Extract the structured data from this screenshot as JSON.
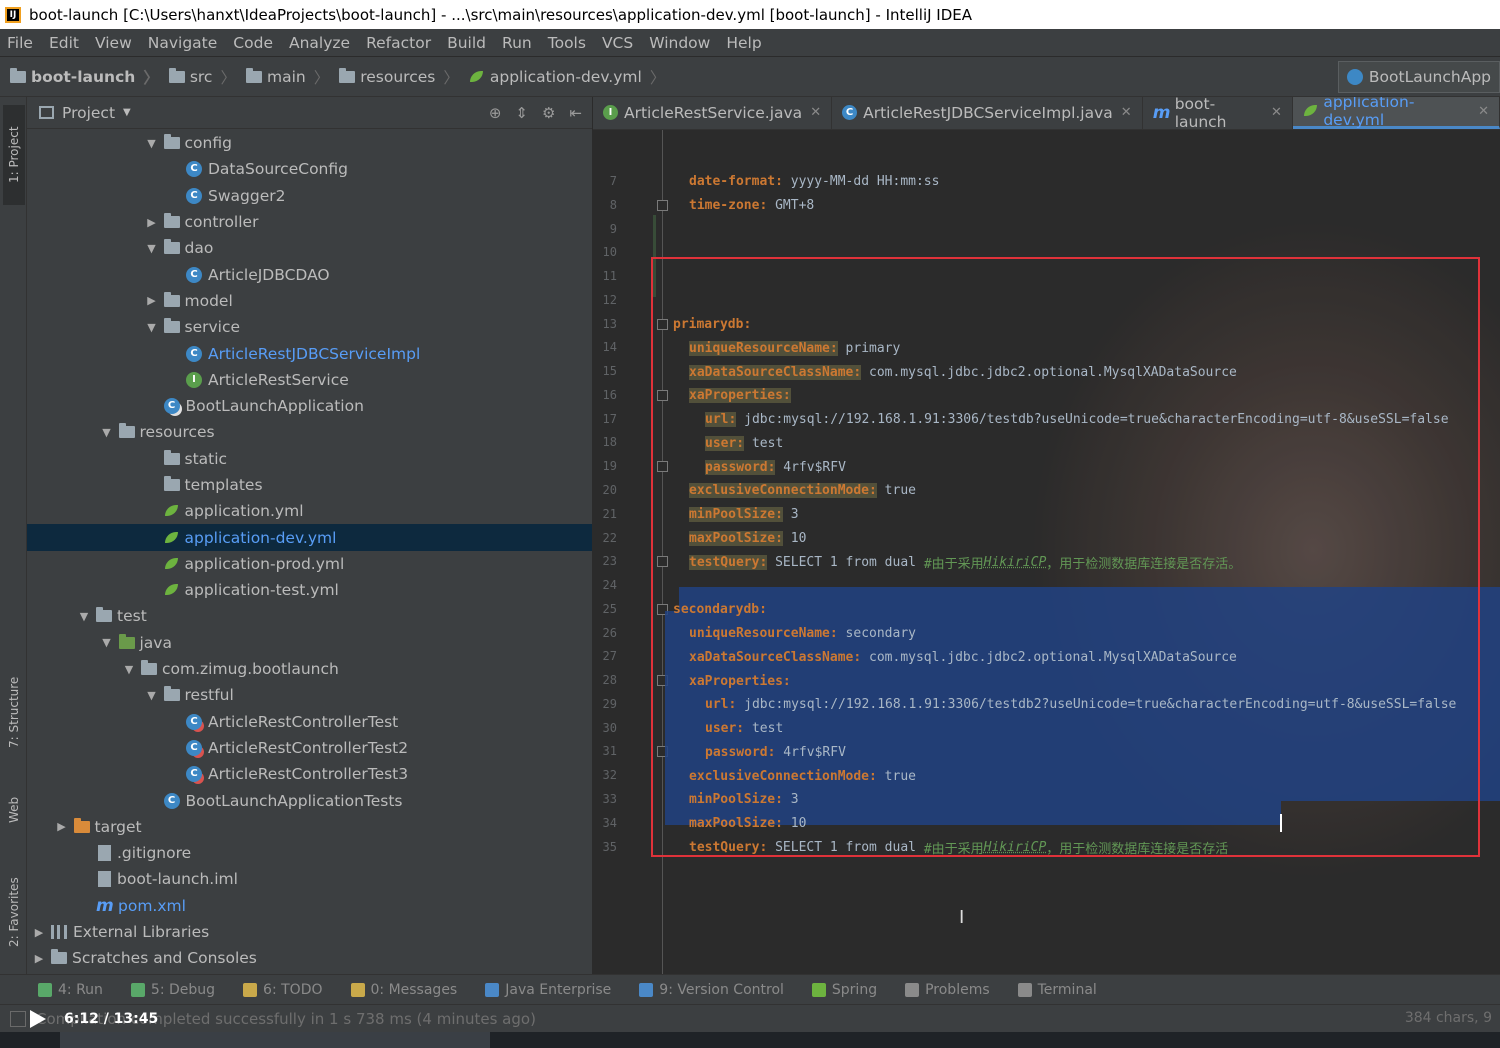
{
  "window": {
    "title": "boot-launch [C:\\Users\\hanxt\\IdeaProjects\\boot-launch] - ...\\src\\main\\resources\\application-dev.yml [boot-launch] - IntelliJ IDEA",
    "app_icon": "IJ"
  },
  "menu": [
    "File",
    "Edit",
    "View",
    "Navigate",
    "Code",
    "Analyze",
    "Refactor",
    "Build",
    "Run",
    "Tools",
    "VCS",
    "Window",
    "Help"
  ],
  "breadcrumbs": [
    "boot-launch",
    "src",
    "main",
    "resources",
    "application-dev.yml"
  ],
  "run_config": "BootLaunchApp",
  "left_tabs": [
    "1: Project",
    "7: Structure",
    "Web",
    "2: Favorites"
  ],
  "project_panel": {
    "title": "Project",
    "tree": [
      {
        "label": "config",
        "type": "folder",
        "expanded": true
      },
      {
        "label": "DataSourceConfig",
        "type": "class"
      },
      {
        "label": "Swagger2",
        "type": "class"
      },
      {
        "label": "controller",
        "type": "folder",
        "expanded": false
      },
      {
        "label": "dao",
        "type": "folder",
        "expanded": true
      },
      {
        "label": "ArticleJDBCDAO",
        "type": "class"
      },
      {
        "label": "model",
        "type": "folder",
        "expanded": false
      },
      {
        "label": "service",
        "type": "folder",
        "expanded": true
      },
      {
        "label": "ArticleRestJDBCServiceImpl",
        "type": "class"
      },
      {
        "label": "ArticleRestService",
        "type": "interface"
      },
      {
        "label": "BootLaunchApplication",
        "type": "app"
      },
      {
        "label": "resources",
        "type": "folder",
        "expanded": true
      },
      {
        "label": "static",
        "type": "folder"
      },
      {
        "label": "templates",
        "type": "folder"
      },
      {
        "label": "application.yml",
        "type": "yml"
      },
      {
        "label": "application-dev.yml",
        "type": "yml",
        "selected": true
      },
      {
        "label": "application-prod.yml",
        "type": "yml"
      },
      {
        "label": "application-test.yml",
        "type": "yml"
      },
      {
        "label": "test",
        "type": "folder",
        "expanded": true
      },
      {
        "label": "java",
        "type": "folder",
        "expanded": true
      },
      {
        "label": "com.zimug.bootlaunch",
        "type": "package",
        "expanded": true
      },
      {
        "label": "restful",
        "type": "package",
        "expanded": true
      },
      {
        "label": "ArticleRestControllerTest",
        "type": "test"
      },
      {
        "label": "ArticleRestControllerTest2",
        "type": "test"
      },
      {
        "label": "ArticleRestControllerTest3",
        "type": "test"
      },
      {
        "label": "BootLaunchApplicationTests",
        "type": "class"
      },
      {
        "label": "target",
        "type": "folder",
        "expanded": false
      },
      {
        "label": ".gitignore",
        "type": "file"
      },
      {
        "label": "boot-launch.iml",
        "type": "file"
      },
      {
        "label": "pom.xml",
        "type": "maven"
      },
      {
        "label": "External Libraries",
        "type": "library",
        "expanded": false
      },
      {
        "label": "Scratches and Consoles",
        "type": "scratch",
        "expanded": false
      }
    ]
  },
  "editor": {
    "tabs": [
      {
        "label": "ArticleRestService.java",
        "icon": "I"
      },
      {
        "label": "ArticleRestJDBCServiceImpl.java",
        "icon": "C"
      },
      {
        "label": "boot-launch",
        "icon": "m"
      },
      {
        "label": "application-dev.yml",
        "icon": "yml",
        "active": true
      }
    ],
    "lines": [
      {
        "n": "7",
        "key": "date-format:",
        "val": " yyyy-MM-dd HH:mm:ss"
      },
      {
        "n": "8",
        "key": "time-zone:",
        "val": " GMT+8"
      },
      {
        "n": "9"
      },
      {
        "n": "10"
      },
      {
        "n": "11"
      },
      {
        "n": "12"
      },
      {
        "n": "13",
        "key": "primarydb:"
      },
      {
        "n": "14",
        "key": "uniqueResourceName:",
        "val": " primary"
      },
      {
        "n": "15",
        "key": "xaDataSourceClassName:",
        "val": " com.mysql.jdbc.jdbc2.optional.MysqlXADataSource"
      },
      {
        "n": "16",
        "key": "xaProperties:"
      },
      {
        "n": "17",
        "key": "url:",
        "val": " jdbc:mysql://192.168.1.91:3306/testdb?useUnicode=true&characterEncoding=utf-8&useSSL=false"
      },
      {
        "n": "18",
        "key": "user:",
        "val": " test"
      },
      {
        "n": "19",
        "key": "password:",
        "val": " 4rfv$RFV"
      },
      {
        "n": "20",
        "key": "exclusiveConnectionMode:",
        "val": " true"
      },
      {
        "n": "21",
        "key": "minPoolSize:",
        "val": " 3"
      },
      {
        "n": "22",
        "key": "maxPoolSize:",
        "val": " 10"
      },
      {
        "n": "23",
        "key": "testQuery:",
        "val": " SELECT 1 from dual ",
        "comment": "#由于采用",
        "comment_u": "HikiriCP",
        "comment2": "，用于检测数据库连接是否存活。"
      },
      {
        "n": "24"
      },
      {
        "n": "25",
        "key": "secondarydb:"
      },
      {
        "n": "26",
        "key": "uniqueResourceName:",
        "val": " secondary"
      },
      {
        "n": "27",
        "key": "xaDataSourceClassName:",
        "val": " com.mysql.jdbc.jdbc2.optional.MysqlXADataSource"
      },
      {
        "n": "28",
        "key": "xaProperties:"
      },
      {
        "n": "29",
        "key": "url:",
        "val": " jdbc:mysql://192.168.1.91:3306/testdb2?useUnicode=true&characterEncoding=utf-8&useSSL=false"
      },
      {
        "n": "30",
        "key": "user:",
        "val": " test"
      },
      {
        "n": "31",
        "key": "password:",
        "val": " 4rfv$RFV"
      },
      {
        "n": "32",
        "key": "exclusiveConnectionMode:",
        "val": " true"
      },
      {
        "n": "33",
        "key": "minPoolSize:",
        "val": " 3"
      },
      {
        "n": "34",
        "key": "maxPoolSize:",
        "val": " 10"
      },
      {
        "n": "35",
        "key": "testQuery:",
        "val": " SELECT 1 from dual ",
        "comment": "#由于采用",
        "comment_u": "HikiriCP",
        "comment2": "，用于检测数据库连接是否存活"
      }
    ]
  },
  "bottom_tabs": [
    {
      "label": "4: Run",
      "color": "#59a869"
    },
    {
      "label": "5: Debug",
      "color": "#59a869"
    },
    {
      "label": "6: TODO",
      "color": "#c9a94a"
    },
    {
      "label": "0: Messages",
      "color": "#c9a94a"
    },
    {
      "label": "Java Enterprise",
      "color": "#4a88c7"
    },
    {
      "label": "9: Version Control",
      "color": "#4a88c7"
    },
    {
      "label": "Spring",
      "color": "#6db33f"
    },
    {
      "label": "Problems",
      "color": "#8a8a8a"
    },
    {
      "label": "Terminal",
      "color": "#8a8a8a"
    }
  ],
  "status": {
    "message": "Compilation completed successfully in 1 s 738 ms (4 minutes ago)",
    "right": "384 chars, 9"
  },
  "video": {
    "time": "6:12 / 13:45"
  }
}
